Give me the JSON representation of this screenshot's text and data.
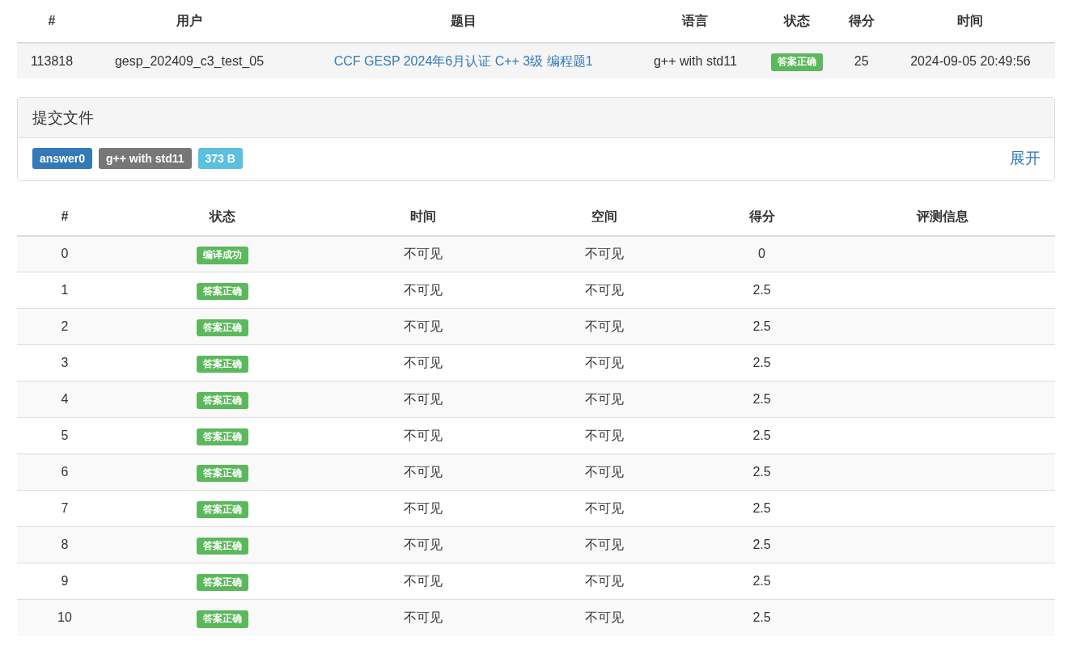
{
  "submission_table": {
    "columns": [
      "#",
      "用户",
      "题目",
      "语言",
      "状态",
      "得分",
      "时间"
    ],
    "row": {
      "id": "113818",
      "user": "gesp_202409_c3_test_05",
      "problem": "CCF GESP 2024年6月认证 C++ 3级 编程题1",
      "language": "g++ with std11",
      "status": "答案正确",
      "score": "25",
      "time": "2024-09-05 20:49:56"
    }
  },
  "files_panel": {
    "title": "提交文件",
    "tags": [
      {
        "text": "answer0",
        "color": "#337ab7"
      },
      {
        "text": "g++ with std11",
        "color": "#777777"
      },
      {
        "text": "373 B",
        "color": "#5bc0de"
      }
    ],
    "toggle": "展开"
  },
  "tests_table": {
    "columns": [
      "#",
      "状态",
      "时间",
      "空间",
      "得分",
      "评测信息"
    ],
    "rows": [
      {
        "num": "0",
        "status": "编译成功",
        "time": "不可见",
        "memory": "不可见",
        "score": "0"
      },
      {
        "num": "1",
        "status": "答案正确",
        "time": "不可见",
        "memory": "不可见",
        "score": "2.5"
      },
      {
        "num": "2",
        "status": "答案正确",
        "time": "不可见",
        "memory": "不可见",
        "score": "2.5"
      },
      {
        "num": "3",
        "status": "答案正确",
        "time": "不可见",
        "memory": "不可见",
        "score": "2.5"
      },
      {
        "num": "4",
        "status": "答案正确",
        "time": "不可见",
        "memory": "不可见",
        "score": "2.5"
      },
      {
        "num": "5",
        "status": "答案正确",
        "time": "不可见",
        "memory": "不可见",
        "score": "2.5"
      },
      {
        "num": "6",
        "status": "答案正确",
        "time": "不可见",
        "memory": "不可见",
        "score": "2.5"
      },
      {
        "num": "7",
        "status": "答案正确",
        "time": "不可见",
        "memory": "不可见",
        "score": "2.5"
      },
      {
        "num": "8",
        "status": "答案正确",
        "time": "不可见",
        "memory": "不可见",
        "score": "2.5"
      },
      {
        "num": "9",
        "status": "答案正确",
        "time": "不可见",
        "memory": "不可见",
        "score": "2.5"
      },
      {
        "num": "10",
        "status": "答案正确",
        "time": "不可见",
        "memory": "不可见",
        "score": "2.5"
      }
    ]
  }
}
